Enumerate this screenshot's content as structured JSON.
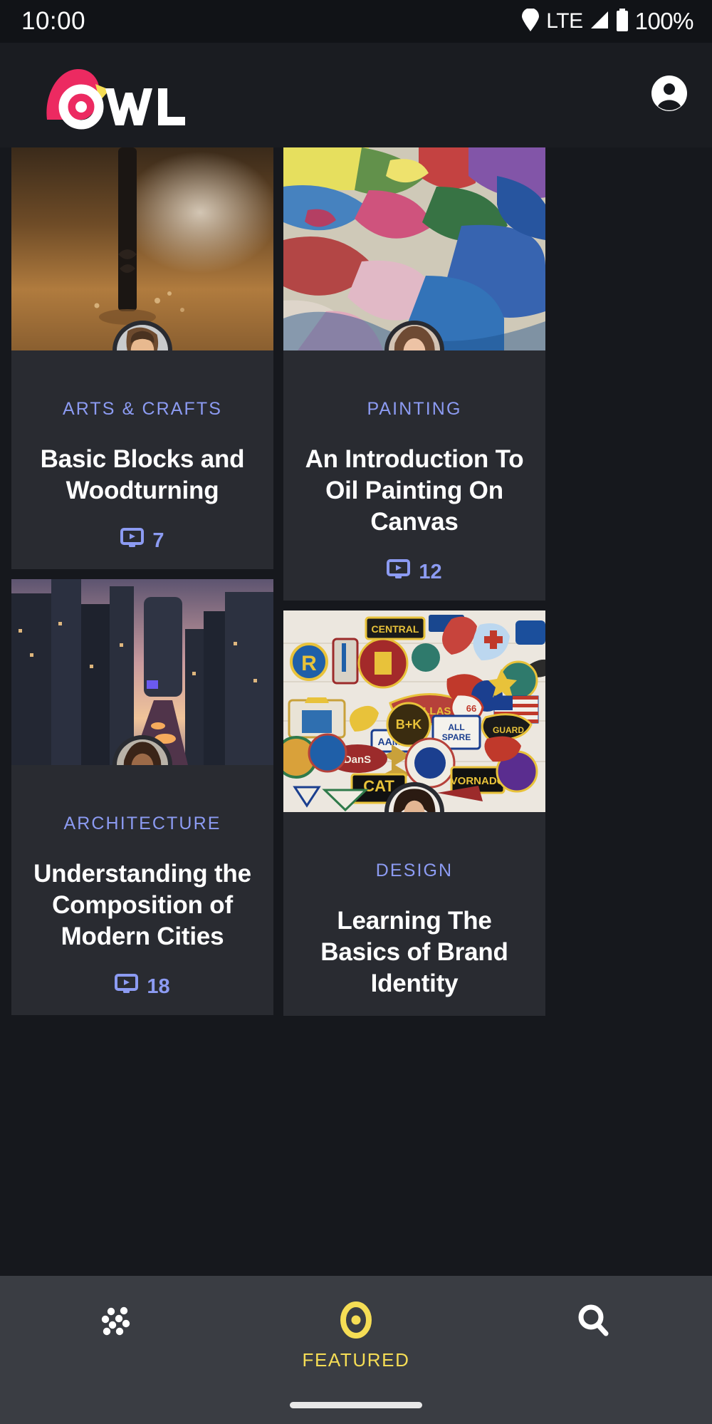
{
  "status_bar": {
    "time": "10:00",
    "network": "LTE",
    "battery": "100%",
    "icons": [
      "location-icon",
      "signal-icon",
      "battery-icon"
    ]
  },
  "header": {
    "brand": "OWL",
    "logo_colors": {
      "bird": "#ec2a61",
      "beak": "#f5dd55",
      "text": "#ffffff"
    },
    "profile_icon": "account-circle-icon"
  },
  "theme": {
    "page_bg": "#16181d",
    "card_bg": "#292b31",
    "accent_category": "#8c9bf2",
    "accent_featured": "#f5dd55"
  },
  "cards": [
    {
      "id": "card-arts-crafts",
      "category": "Arts & Crafts",
      "title": "Basic Blocks and Woodturning",
      "video_count": "7",
      "video_icon": "monitor-play-icon",
      "thumb_alt": "drill-bit-boring-into-wood",
      "avatar_alt": "young-man-smiling-avatar"
    },
    {
      "id": "card-painting",
      "category": "Painting",
      "title": "An Introduction To Oil Painting On Canvas",
      "video_count": "12",
      "video_icon": "monitor-play-icon",
      "thumb_alt": "oil-paint-palette-colors",
      "avatar_alt": "woman-portrait-avatar"
    },
    {
      "id": "card-architecture",
      "category": "Architecture",
      "title": "Understanding the Composition of Modern Cities",
      "video_count": "18",
      "video_icon": "monitor-play-icon",
      "thumb_alt": "city-skyline-at-dusk",
      "avatar_alt": "smiling-woman-avatar"
    },
    {
      "id": "card-design",
      "category": "Design",
      "title": "Learning The Basics of Brand Identity",
      "video_count": "",
      "video_icon": "monitor-play-icon",
      "thumb_alt": "wall-of-embroidered-patches",
      "avatar_alt": "short-hair-woman-avatar"
    }
  ],
  "bottom_nav": {
    "items": [
      {
        "name": "browse",
        "label": "",
        "icon": "dot-grid-icon",
        "active": false
      },
      {
        "name": "featured",
        "label": "FEATURED",
        "icon": "eye-target-icon",
        "active": true
      },
      {
        "name": "search",
        "label": "",
        "icon": "search-icon",
        "active": false
      }
    ]
  }
}
